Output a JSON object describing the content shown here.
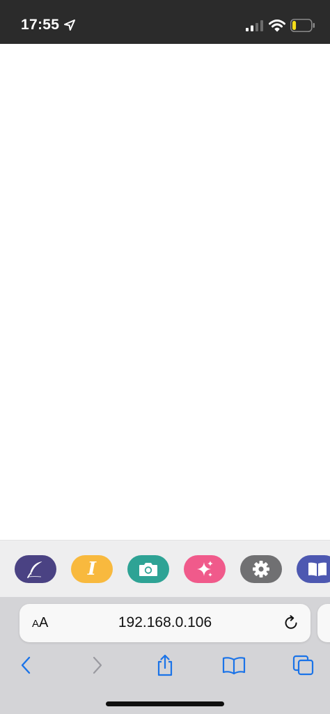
{
  "status_bar": {
    "time": "17:55",
    "location_icon": "location-arrow-icon",
    "signal_icon": "cellular-signal-icon",
    "wifi_icon": "wifi-icon",
    "battery_icon": "battery-low-icon",
    "battery_level": 0.2
  },
  "app_toolbar": {
    "buttons": [
      {
        "id": "write",
        "icon": "feather-quill-icon",
        "color": "#4a4283"
      },
      {
        "id": "text",
        "icon": "italic-text-icon",
        "glyph": "I",
        "color": "#f8b93e"
      },
      {
        "id": "camera",
        "icon": "camera-icon",
        "color": "#2ea395"
      },
      {
        "id": "magic",
        "icon": "sparkles-icon",
        "color": "#f05a8b"
      },
      {
        "id": "settings",
        "icon": "gear-icon",
        "color": "#707072"
      },
      {
        "id": "book",
        "icon": "open-book-icon",
        "color": "#4d58b1"
      }
    ]
  },
  "safari": {
    "text_size_small": "A",
    "text_size_large": "A",
    "url": "192.168.0.106",
    "reload_icon": "reload-icon",
    "accent_color": "#1a73e8",
    "nav": {
      "back_icon": "chevron-left-icon",
      "forward_icon": "chevron-right-icon",
      "share_icon": "share-icon",
      "bookmarks_icon": "bookmarks-icon",
      "tabs_icon": "tabs-icon"
    }
  }
}
